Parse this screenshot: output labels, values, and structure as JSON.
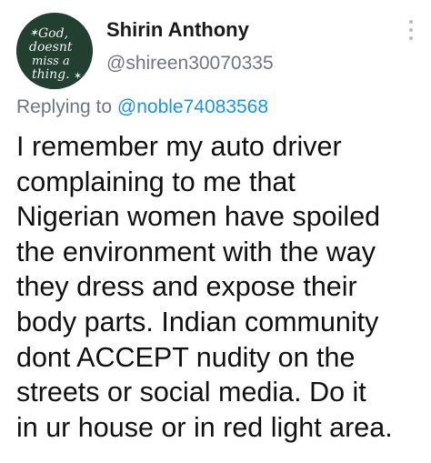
{
  "tweet": {
    "author": {
      "display_name": "Shirin Anthony",
      "handle": "@shireen30070335",
      "avatar_text": [
        "God,",
        "doesnt",
        "miss a",
        "thing."
      ]
    },
    "reply": {
      "prefix": "Replying to",
      "mention": "@noble74083568"
    },
    "body_lines": [
      "I remember my auto driver",
      "complaining to me that",
      "Nigerian women have spoiled",
      "the environment with the way",
      "they dress and expose their",
      "body parts. Indian community",
      "dont ACCEPT nudity on the",
      "streets or social media. Do it",
      "in ur house or in red light area."
    ],
    "more_icon": "more-vertical-icon"
  },
  "colors": {
    "avatar_bg": "#233f32",
    "mention": "#1b95e0",
    "secondary_text": "#6e7781"
  }
}
